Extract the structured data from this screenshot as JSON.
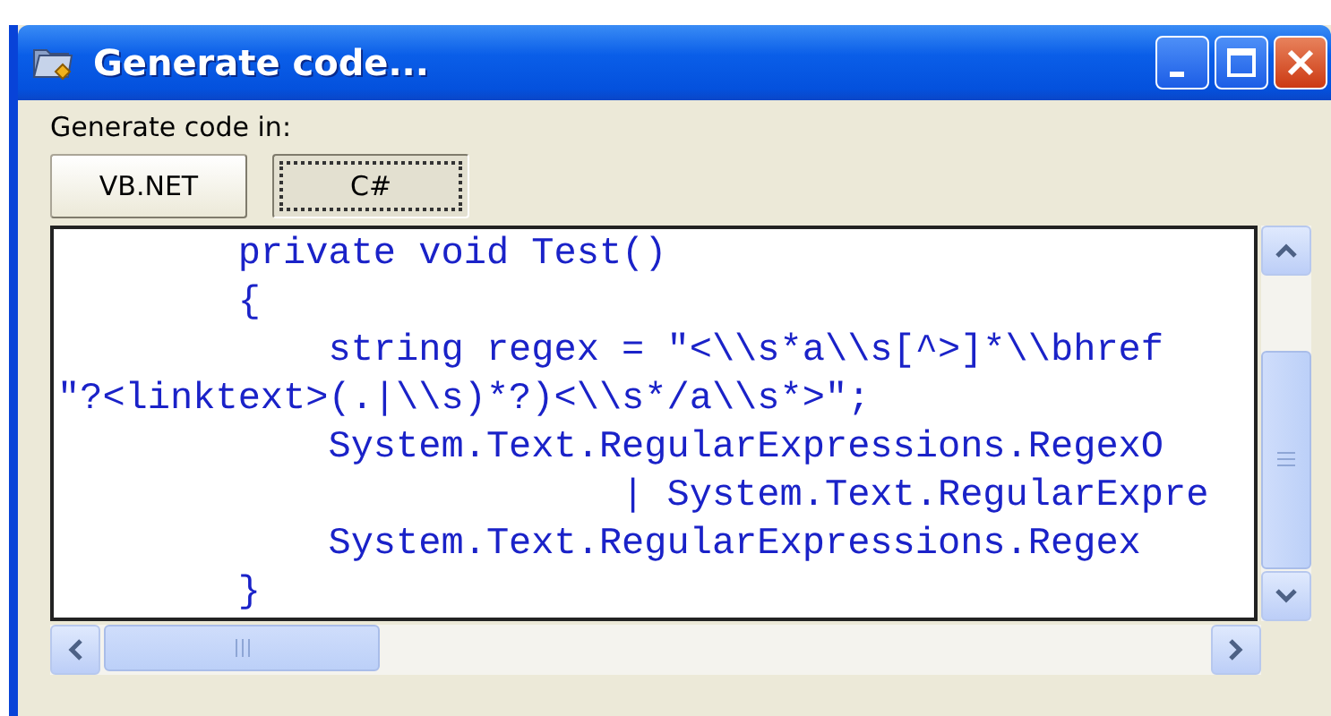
{
  "window": {
    "title": "Generate code..."
  },
  "prompt": "Generate code in:",
  "languages": [
    {
      "label": "VB.NET",
      "selected": false
    },
    {
      "label": "C#",
      "selected": true
    }
  ],
  "code": {
    "lines": [
      "        private void Test()",
      "        {",
      "            string regex = \"<\\\\s*a\\\\s[^>]*\\\\bhref",
      "\"?<linktext>(.|\\\\s)*?)<\\\\s*/a\\\\s*>\";",
      "            System.Text.RegularExpressions.RegexO",
      "                         | System.Text.RegularExpre",
      "            System.Text.RegularExpressions.Regex",
      "        }"
    ]
  }
}
